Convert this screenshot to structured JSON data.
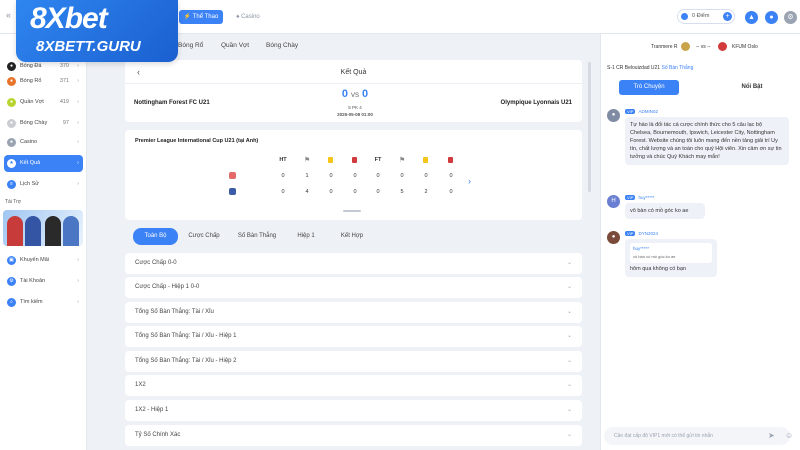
{
  "brand": {
    "logo": "8Xbet",
    "site": "8XBETT.GURU"
  },
  "topbar": {
    "sport_tab": "Thể Thao",
    "casino_tab": "Casino",
    "balance": "0 Điểm",
    "plus": "+"
  },
  "sidebar": {
    "items": [
      {
        "label": "Bóng Đá",
        "count": "370"
      },
      {
        "label": "Bóng Rổ",
        "count": "371"
      },
      {
        "label": "Quần Vợt",
        "count": "419"
      },
      {
        "label": "Bóng Chày",
        "count": "97"
      },
      {
        "label": "Casino",
        "count": ""
      },
      {
        "label": "Kết Quả",
        "count": ""
      },
      {
        "label": "Lịch Sử",
        "count": ""
      }
    ],
    "promo_title": "Tái Trợ",
    "bottom": [
      {
        "label": "Khuyến Mãi"
      },
      {
        "label": "Tài Khoản"
      },
      {
        "label": "Tìm kiếm"
      }
    ]
  },
  "subnav": [
    "Bóng Rổ",
    "Quần Vợt",
    "Bóng Chày"
  ],
  "match": {
    "page_title": "Kết Quả",
    "home": "Nottingham Forest FC U21",
    "away": "Olympique Lyonnais U21",
    "home_score": "0",
    "away_score": "0",
    "vs": "VS",
    "status": "5 PK 4",
    "datetime": "2025-05-08 01:00"
  },
  "stats": {
    "competition": "Premier League International Cup U21 (tại Anh)",
    "headers": [
      "HT",
      "",
      "",
      "",
      "FT",
      "",
      "",
      ""
    ],
    "rows": [
      [
        "0",
        "1",
        "0",
        "0",
        "0",
        "0",
        "0",
        "0"
      ],
      [
        "0",
        "4",
        "0",
        "0",
        "0",
        "5",
        "2",
        "0"
      ]
    ]
  },
  "tabs": [
    "Toàn Bộ",
    "Cược Chấp",
    "Số Bàn Thắng",
    "Hiệp 1",
    "Kết Hợp"
  ],
  "odds": [
    "Cược Chấp 0-0",
    "Cược Chấp - Hiệp 1 0-0",
    "Tổng Số Bàn Thắng: Tài / Xỉu",
    "Tổng Số Bàn Thắng: Tài / Xỉu - Hiệp 1",
    "Tổng Số Bàn Thắng: Tài / Xỉu - Hiệp 2",
    "1X2",
    "1X2 - Hiệp 1",
    "Tỷ Số Chính Xác"
  ],
  "right": {
    "mini_home": "Tranmere R",
    "mini_score": "-- vs --",
    "mini_away": "KFUM Oslo",
    "live_line": "S-1  CR Belouizdad U21",
    "live_sub": "Số Bàn Thắng",
    "chat_tab": "Trò Chuyện",
    "feature_tab": "Nổi Bật",
    "messages": [
      {
        "vip": "VIP",
        "name": "ADMIN02",
        "text": "Tự hào là đối tác cá cược chính thức cho 5 câu lạc bộ Chelsea, Bournemouth, Ipswich, Leicester City, Nottingham Forest. Website chúng tôi luôn mang đến nền tảng giải trí Uy tín, chất lượng và an toàn cho quý Hội viên. Xin cảm ơn sự tin tưởng và chúc Quý Khách may mắn!"
      },
      {
        "vip": "VIP",
        "name": "huy*****",
        "text": "vô bàn có mồ góc ko ae"
      },
      {
        "vip": "VIP",
        "name": "DYN2024",
        "quote_name": "huy*****",
        "quote_text": "vô bàn có mồ góc ko ae",
        "text": "hôm qua không có bạn"
      }
    ],
    "input_placeholder": "Cần đạt cấp độ VIP1 mới có thể gửi tin nhắn"
  },
  "colors": {
    "accent": "#3b82f6",
    "yellow": "#f5c518",
    "red": "#d23b3b"
  }
}
